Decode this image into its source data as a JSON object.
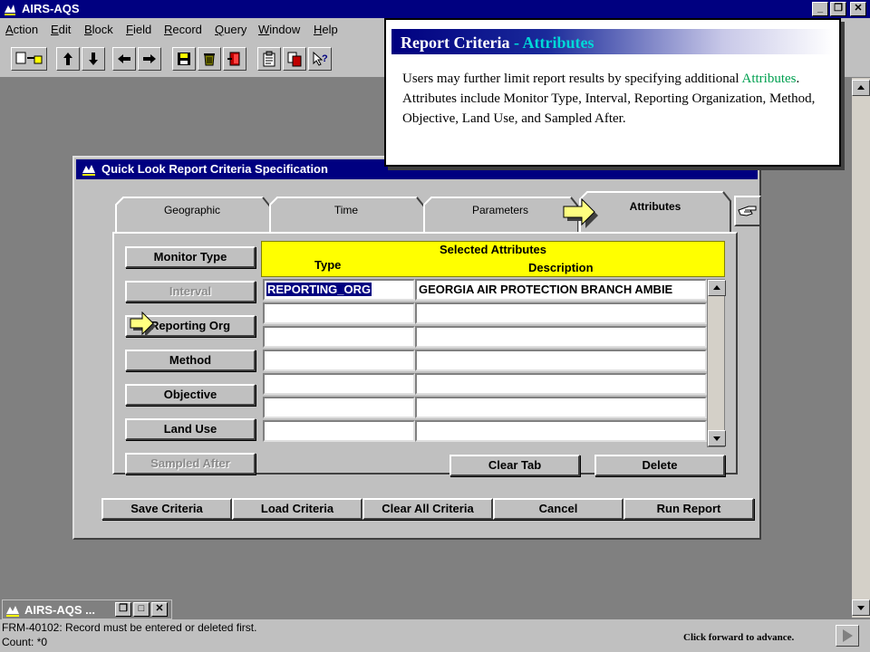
{
  "app": {
    "title": "AIRS-AQS",
    "window_buttons": {
      "minimize": "_",
      "restore": "❐",
      "close": "✕"
    }
  },
  "menu": [
    {
      "label": "Action",
      "u": "A"
    },
    {
      "label": "Edit",
      "u": "E"
    },
    {
      "label": "Block",
      "u": "B"
    },
    {
      "label": "Field",
      "u": "F"
    },
    {
      "label": "Record",
      "u": "R"
    },
    {
      "label": "Query",
      "u": "Q"
    },
    {
      "label": "Window",
      "u": "W"
    },
    {
      "label": "Help",
      "u": "H"
    }
  ],
  "toolbar": {
    "icons": [
      "enter-query-icon",
      "arrow-up-icon",
      "arrow-down-icon",
      "arrow-left-icon",
      "arrow-right-icon",
      "save-icon",
      "trash-icon",
      "exit-icon",
      "clipboard-icon",
      "copy-icon",
      "help-query-icon"
    ]
  },
  "tooltip": {
    "title_main": "Report Criteria",
    "title_sep": " - ",
    "title_accent": "Attributes",
    "body_pre": "Users may further limit report results by specifying additional ",
    "body_keyword": "Attributes",
    "body_post": ".  Attributes include Monitor Type, Interval, Reporting Organization, Method, Objective, Land Use, and Sampled After."
  },
  "dialog": {
    "title": "Quick Look Report Criteria Specification",
    "tabs": [
      "Geographic",
      "Time",
      "Parameters",
      "Attributes"
    ],
    "active_tab": "Attributes",
    "left_buttons": [
      {
        "label": "Monitor Type",
        "enabled": true
      },
      {
        "label": "Interval",
        "enabled": false
      },
      {
        "label": "Reporting Org",
        "enabled": true
      },
      {
        "label": "Method",
        "enabled": true
      },
      {
        "label": "Objective",
        "enabled": true
      },
      {
        "label": "Land Use",
        "enabled": true
      },
      {
        "label": "Sampled After",
        "enabled": false
      }
    ],
    "grid": {
      "title": "Selected Attributes",
      "col_type": "Type",
      "col_desc": "Description",
      "rows": [
        {
          "type": "REPORTING_ORG",
          "desc": "GEORGIA AIR PROTECTION BRANCH AMBIE"
        },
        {
          "type": "",
          "desc": ""
        },
        {
          "type": "",
          "desc": ""
        },
        {
          "type": "",
          "desc": ""
        },
        {
          "type": "",
          "desc": ""
        },
        {
          "type": "",
          "desc": ""
        },
        {
          "type": "",
          "desc": ""
        }
      ]
    },
    "panel_buttons": {
      "clear_tab": "Clear Tab",
      "delete": "Delete"
    },
    "bottom_buttons": [
      "Save Criteria",
      "Load Criteria",
      "Clear All Criteria",
      "Cancel",
      "Run Report"
    ]
  },
  "minimized": {
    "title": "AIRS-AQS ..."
  },
  "status": {
    "line1": "FRM-40102: Record must be entered or deleted first.",
    "line2": "Count: *0",
    "advance": "Click forward to advance."
  },
  "colors": {
    "titlebar": "#000080",
    "highlight_yellow": "#ffff00",
    "tooltip_accent": "#00d8d8",
    "keyword_green": "#00a050"
  }
}
